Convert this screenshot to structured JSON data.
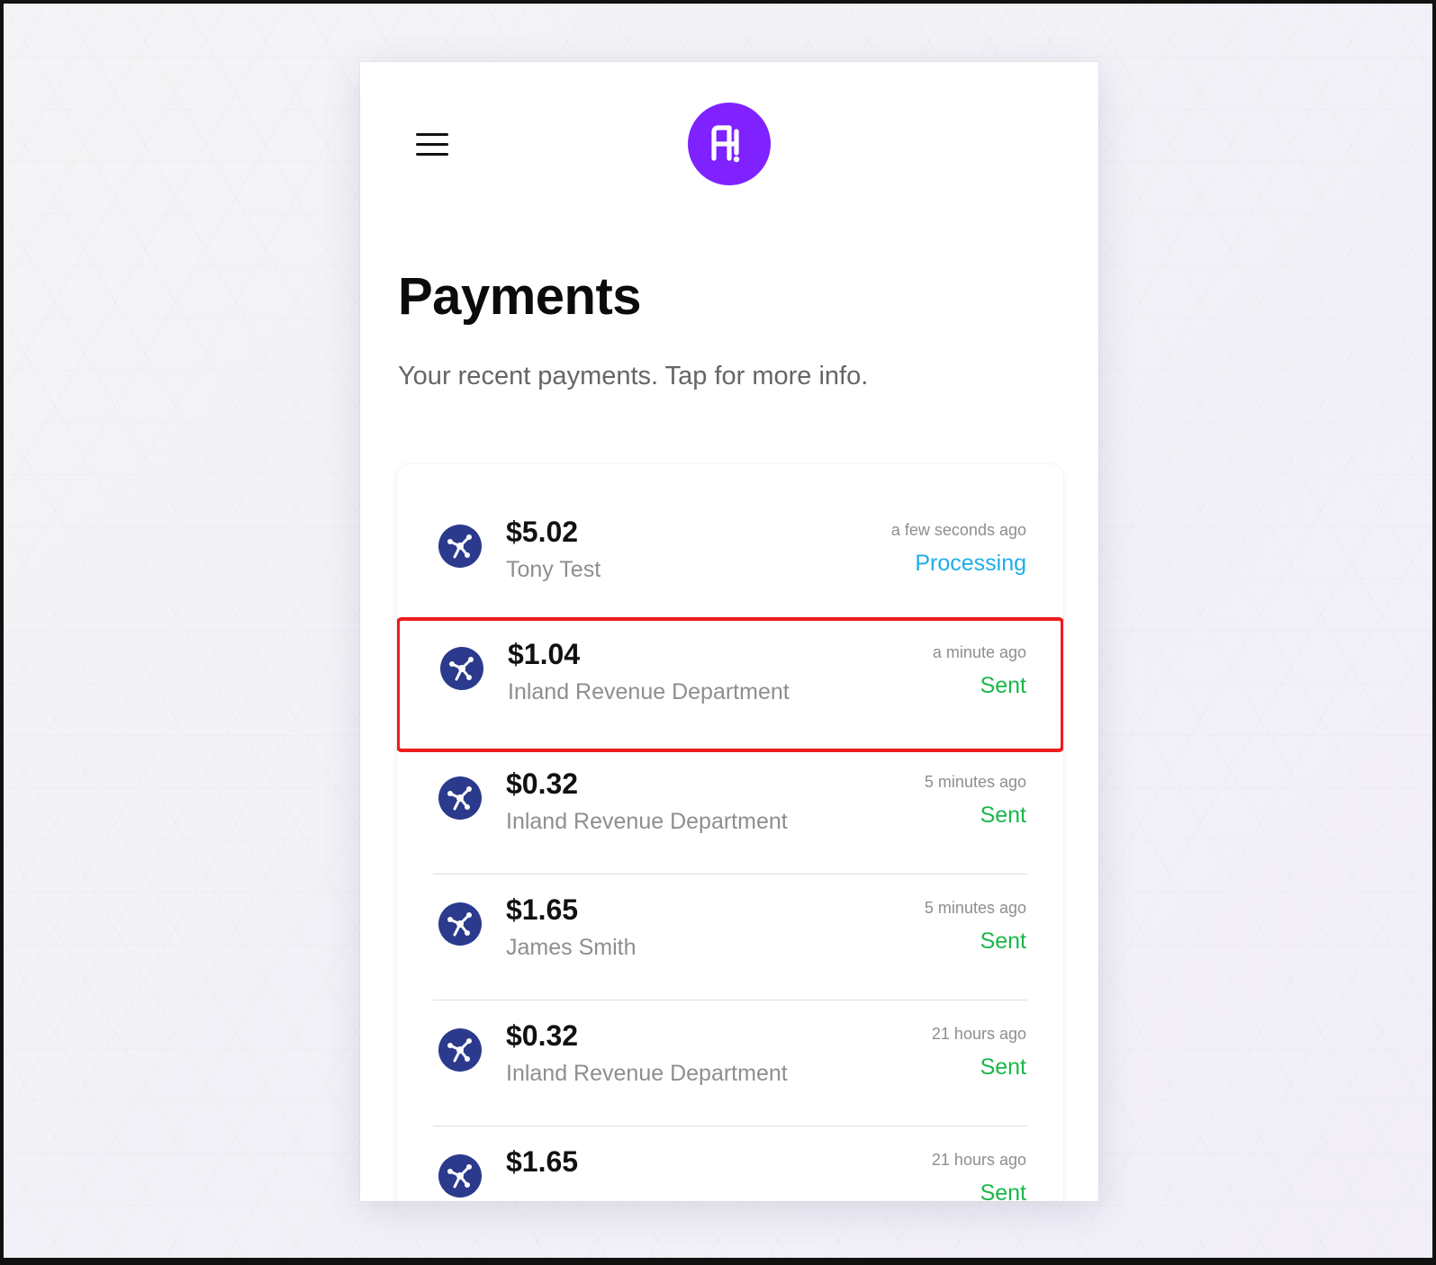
{
  "app": {
    "menu_icon": "hamburger-menu-icon",
    "logo_icon": "brand-logo-icon",
    "brand_color": "#7f22ff"
  },
  "page": {
    "title": "Payments",
    "subtitle": "Your recent payments. Tap for more info."
  },
  "colors": {
    "processing": "#1eaee8",
    "sent": "#19b84a",
    "payee_icon": "#2b3a8c",
    "highlight_border": "#ee1c1c"
  },
  "payments": [
    {
      "amount": "$5.02",
      "payee": "Tony Test",
      "time": "a few seconds ago",
      "status": "Processing",
      "status_type": "processing",
      "icon": "payee-network-icon"
    },
    {
      "amount": "$1.04",
      "payee": "Inland Revenue Department",
      "time": "a minute ago",
      "status": "Sent",
      "status_type": "sent",
      "icon": "payee-network-icon"
    },
    {
      "amount": "$0.32",
      "payee": "Inland Revenue Department",
      "time": "5 minutes ago",
      "status": "Sent",
      "status_type": "sent",
      "icon": "payee-network-icon"
    },
    {
      "amount": "$1.65",
      "payee": "James Smith",
      "time": "5 minutes ago",
      "status": "Sent",
      "status_type": "sent",
      "icon": "payee-network-icon"
    },
    {
      "amount": "$0.32",
      "payee": "Inland Revenue Department",
      "time": "21 hours ago",
      "status": "Sent",
      "status_type": "sent",
      "icon": "payee-network-icon"
    },
    {
      "amount": "$1.65",
      "payee": "",
      "time": "21 hours ago",
      "status": "Sent",
      "status_type": "sent",
      "icon": "payee-network-icon"
    }
  ]
}
